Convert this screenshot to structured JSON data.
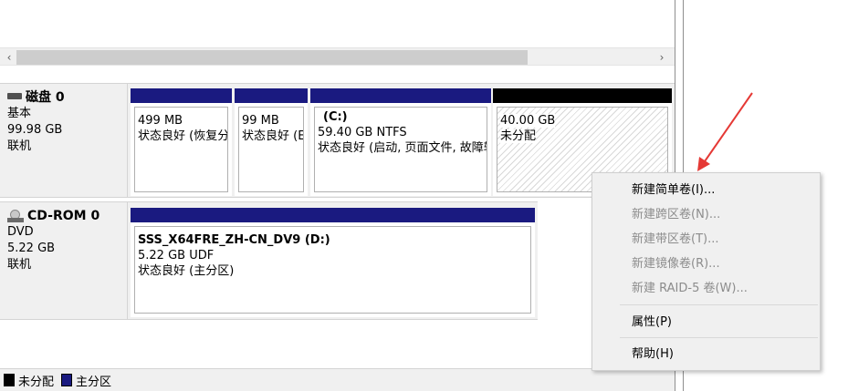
{
  "scrollbar": {
    "left_arrow": "‹",
    "right_arrow": "›"
  },
  "disks": [
    {
      "name": "磁盘 0",
      "type": "基本",
      "size": "99.98 GB",
      "status": "联机",
      "icon": "disk-icon",
      "partitions": [
        {
          "title": "",
          "size": "499 MB",
          "status": "状态良好 (恢复分区)"
        },
        {
          "title": "",
          "size": "99 MB",
          "status": "状态良好 (EFI 系统分区)"
        },
        {
          "title": "(C:)",
          "size": "59.40 GB NTFS",
          "status": "状态良好 (启动, 页面文件, 故障转储, 基本数据分区)"
        },
        {
          "title": "",
          "size": "40.00 GB",
          "status": "未分配"
        }
      ]
    },
    {
      "name": "CD-ROM 0",
      "type": "DVD",
      "size": "5.22 GB",
      "status": "联机",
      "icon": "cd-icon",
      "partitions": [
        {
          "title": "SSS_X64FRE_ZH-CN_DV9  (D:)",
          "size": "5.22 GB UDF",
          "status": "状态良好 (主分区)"
        }
      ]
    }
  ],
  "legend": {
    "unallocated": "未分配",
    "primary": "主分区"
  },
  "context_menu": {
    "items": [
      {
        "label": "新建简单卷(I)...",
        "enabled": true
      },
      {
        "label": "新建跨区卷(N)...",
        "enabled": false
      },
      {
        "label": "新建带区卷(T)...",
        "enabled": false
      },
      {
        "label": "新建镜像卷(R)...",
        "enabled": false
      },
      {
        "label": "新建 RAID-5 卷(W)...",
        "enabled": false
      },
      {
        "label": "属性(P)",
        "enabled": true
      },
      {
        "label": "帮助(H)",
        "enabled": true
      }
    ]
  },
  "colors": {
    "primary_partition": "#1a1a80",
    "unallocated": "#000000",
    "annotation_arrow": "#e53935"
  }
}
